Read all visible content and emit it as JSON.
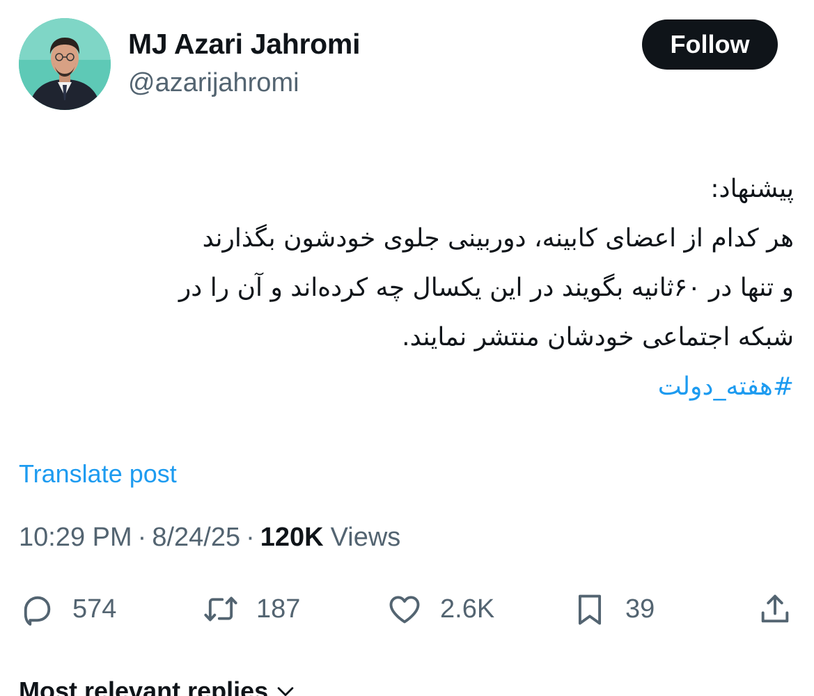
{
  "author": {
    "display_name": "MJ Azari Jahromi",
    "handle": "@azarijahromi",
    "avatar_icon": "profile-photo"
  },
  "follow_label": "Follow",
  "post": {
    "lines": [
      "پیشنهاد:",
      "هر کدام از اعضای کابینه، دوربینی جلوی خودشون بگذارند",
      "و تنها در ۶۰ثانیه بگویند در این یکسال چه کرده‌اند و آن را در",
      "شبکه اجتماعی خودشان منتشر نمایند."
    ],
    "hashtag": "#هفته_دولت"
  },
  "translate_label": "Translate post",
  "meta": {
    "time": "10:29 PM",
    "separator": "·",
    "date": "8/24/25",
    "views_count": "120K",
    "views_label": "Views"
  },
  "actions": {
    "replies": "574",
    "reposts": "187",
    "likes": "2.6K",
    "bookmarks": "39"
  },
  "replies_sort_label": "Most relevant replies",
  "colors": {
    "accent": "#1d9bf0",
    "text": "#0f1419",
    "muted": "#536471",
    "button_bg": "#0f1419"
  }
}
